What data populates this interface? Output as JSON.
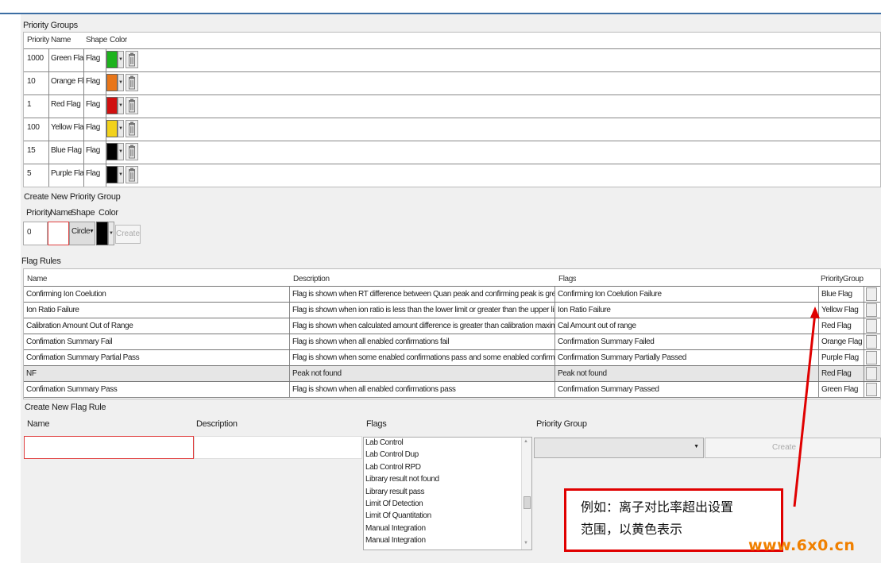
{
  "priority_groups": {
    "title": "Priority Groups",
    "headers": {
      "priority": "Priority",
      "name": "Name",
      "shape": "Shape",
      "color": "Color"
    },
    "rows": [
      {
        "priority": "1000",
        "name": "Green Flag",
        "shape": "Flag",
        "color": "#1db31d"
      },
      {
        "priority": "10",
        "name": "Orange Flag",
        "shape": "Flag",
        "color": "#e8761a"
      },
      {
        "priority": "1",
        "name": "Red Flag",
        "shape": "Flag",
        "color": "#d01010"
      },
      {
        "priority": "100",
        "name": "Yellow Flag",
        "shape": "Flag",
        "color": "#f2d21c"
      },
      {
        "priority": "15",
        "name": "Blue Flag",
        "shape": "Flag",
        "color": "#000000"
      },
      {
        "priority": "5",
        "name": "Purple Flag",
        "shape": "Flag",
        "color": "#000000"
      }
    ]
  },
  "create_priority_group": {
    "title": "Create New Priority Group",
    "labels": {
      "priority": "Priority",
      "name": "Name",
      "shape": "Shape",
      "color": "Color"
    },
    "priority_value": "0",
    "shape_value": "Circle",
    "color": "#000000",
    "create_label": "Create"
  },
  "flag_rules": {
    "title": "Flag Rules",
    "headers": {
      "name": "Name",
      "description": "Description",
      "flags": "Flags",
      "priority_group": "PriorityGroup"
    },
    "rows": [
      {
        "name": "Confirming Ion Coelution",
        "description": "Flag is shown when RT difference between Quan peak and confirming peak is greater than coelutic",
        "flags": "Confirming Ion Coelution Failure",
        "group": "Blue Flag"
      },
      {
        "name": "Ion Ratio Failure",
        "description": "Flag is shown when ion ratio is less than the lower limit or greater than the upper limit",
        "flags": "Ion Ratio Failure",
        "group": "Yellow Flag"
      },
      {
        "name": "Calibration Amount Out of Range",
        "description": "Flag is shown when calculated amount difference is greater than calibration maximum amount diffi",
        "flags": "Cal Amount out of range",
        "group": "Red Flag"
      },
      {
        "name": "Confimation Summary Fail",
        "description": "Flag is shown when all enabled confirmations fail",
        "flags": "Confirmation Summary Failed",
        "group": "Orange Flag"
      },
      {
        "name": "Confimation Summary Partial Pass",
        "description": "Flag is shown when some enabled confirmations pass and some enabled confirmations fail",
        "flags": "Confirmation Summary Partially Passed",
        "group": "Purple Flag"
      },
      {
        "name": "NF",
        "description": "Peak not found",
        "flags": "Peak not found",
        "group": "Red Flag"
      },
      {
        "name": "Confimation Summary Pass",
        "description": "Flag is shown when all enabled confirmations pass",
        "flags": "Confirmation Summary Passed",
        "group": "Green Flag"
      }
    ]
  },
  "create_flag_rule": {
    "title": "Create New Flag Rule",
    "labels": {
      "name": "Name",
      "description": "Description",
      "flags": "Flags",
      "priority_group": "Priority Group"
    },
    "flags_list": [
      "Lab Control",
      "Lab Control Dup",
      "Lab Control RPD",
      "Library result not found",
      "Library result pass",
      "Limit Of Detection",
      "Limit Of Quantitation",
      "Manual Integration",
      "Manual Integration"
    ],
    "create_label": "Create"
  },
  "annotation": {
    "line1": "例如：离子对比率超出设置",
    "line2": "范围，以黄色表示",
    "color": "#e00000"
  },
  "watermark": "www.6x0.cn"
}
